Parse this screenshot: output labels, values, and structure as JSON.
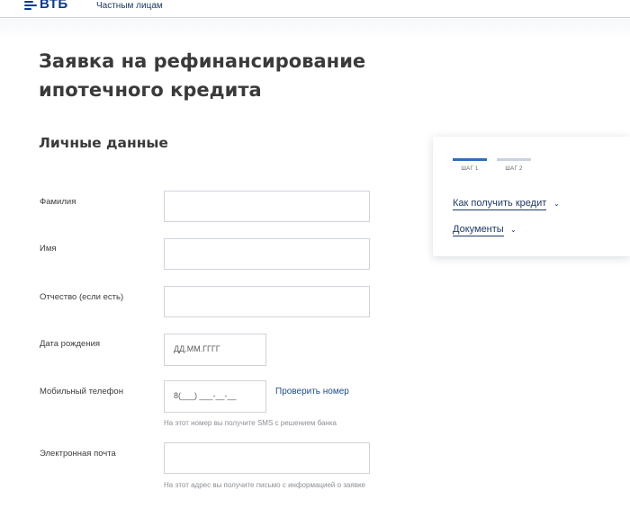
{
  "header": {
    "logo_text": "ВТБ",
    "nav_private": "Частным лицам"
  },
  "page": {
    "title": "Заявка на рефинансирование ипотечного кредита",
    "section_title": "Личные данные"
  },
  "form": {
    "surname_label": "Фамилия",
    "name_label": "Имя",
    "patronymic_label": "Отчество (если есть)",
    "birthdate_label": "Дата рождения",
    "birthdate_placeholder": "ДД.ММ.ГГГГ",
    "phone_label": "Мобильный телефон",
    "phone_placeholder": "8(___) ___-__-__",
    "verify_link": "Проверить номер",
    "phone_hint": "На этот номер вы получите SMS с решением банка",
    "email_label": "Электронная почта",
    "email_hint": "На этот адрес вы получите письмо с информацией о заявке"
  },
  "sidebar": {
    "steps": [
      {
        "label": "ШАГ 1",
        "active": true
      },
      {
        "label": "ШАГ 2",
        "active": false
      }
    ],
    "how_to_get": "Как получить кредит",
    "documents": "Документы"
  },
  "colors": {
    "brand": "#0a3a8c",
    "link": "#1d4d8c",
    "step_active": "#2f6fb8",
    "step_inactive": "#c9d3de"
  }
}
